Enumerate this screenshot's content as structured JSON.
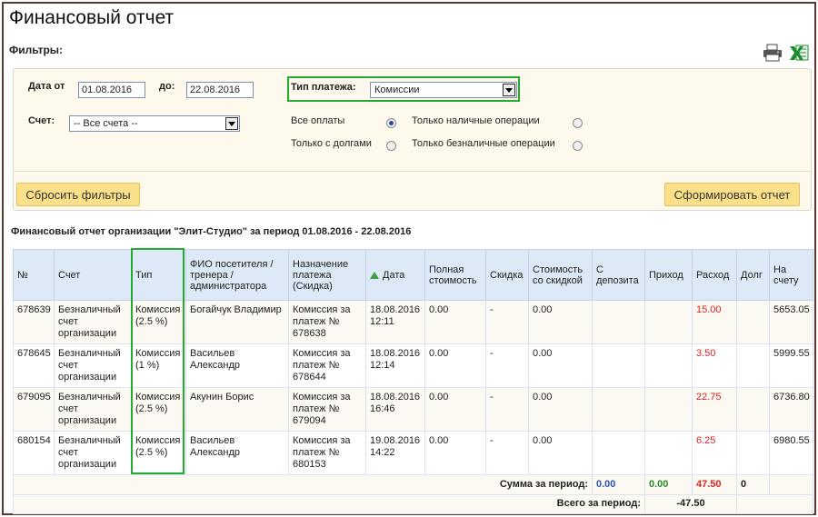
{
  "page": {
    "title": "Финансовый отчет"
  },
  "filters": {
    "title": "Фильтры:",
    "date_from_label": "Дата от",
    "date_from_value": "01.08.2016",
    "date_to_label": "до:",
    "date_to_value": "22.08.2016",
    "payment_type_label": "Тип платежа:",
    "payment_type_value": "Комиссии",
    "account_label": "Счет:",
    "account_value": "-- Все счета --",
    "radio_all": "Все оплаты",
    "radio_debts": "Только с долгами",
    "radio_cash": "Только наличные операции",
    "radio_noncash": "Только безналичные операции",
    "selected_radio": "all",
    "reset_button": "Сбросить фильтры",
    "generate_button": "Сформировать отчет"
  },
  "icons": {
    "print": "printer-icon",
    "excel": "excel-icon"
  },
  "report": {
    "title": "Финансовый отчет организации \"Элит-Студио\" за период 01.08.2016 - 22.08.2016",
    "columns": [
      "№",
      "Счет",
      "Тип",
      "ФИО посетителя / тренера / администратора",
      "Назначение платежа (Скидка)",
      "Дата",
      "Полная стоимость",
      "Скидка",
      "Стоимость со скидкой",
      "С депозита",
      "Приход",
      "Расход",
      "Долг",
      "На счету"
    ],
    "rows": [
      {
        "num": "678639",
        "account": "Безналичный счет организации",
        "type": "Комиссия (2.5 %)",
        "person": "Богайчук Владимир",
        "purpose": "Комиссия за платеж № 678638",
        "date": "18.08.2016 12:11",
        "full": "0.00",
        "discount": "-",
        "discounted": "0.00",
        "deposit": "",
        "income": "",
        "expense": "15.00",
        "debt": "",
        "balance": "5653.05"
      },
      {
        "num": "678645",
        "account": "Безналичный счет организации",
        "type": "Комиссия (1 %)",
        "person": "Васильев Александр",
        "purpose": "Комиссия за платеж № 678644",
        "date": "18.08.2016 12:14",
        "full": "0.00",
        "discount": "-",
        "discounted": "0.00",
        "deposit": "",
        "income": "",
        "expense": "3.50",
        "debt": "",
        "balance": "5999.55"
      },
      {
        "num": "679095",
        "account": "Безналичный счет организации",
        "type": "Комиссия (2.5 %)",
        "person": "Акунин Борис",
        "purpose": "Комиссия за платеж № 679094",
        "date": "18.08.2016 16:46",
        "full": "0.00",
        "discount": "-",
        "discounted": "0.00",
        "deposit": "",
        "income": "",
        "expense": "22.75",
        "debt": "",
        "balance": "6736.80"
      },
      {
        "num": "680154",
        "account": "Безналичный счет организации",
        "type": "Комиссия (2.5 %)",
        "person": "Васильев Александр",
        "purpose": "Комиссия за платеж № 680153",
        "date": "19.08.2016 14:22",
        "full": "0.00",
        "discount": "-",
        "discounted": "0.00",
        "deposit": "",
        "income": "",
        "expense": "6.25",
        "debt": "",
        "balance": "6980.55"
      }
    ],
    "sum_label": "Сумма за период:",
    "sum_deposit": "0.00",
    "sum_income": "0.00",
    "sum_expense": "47.50",
    "sum_debt": "0",
    "total_label": "Всего за период:",
    "total_value": "-47.50"
  },
  "colors": {
    "highlight": "#22aa33",
    "expense": "#e02020",
    "header_bg": "#dde9f6",
    "button_bg": "#fbe08a"
  }
}
